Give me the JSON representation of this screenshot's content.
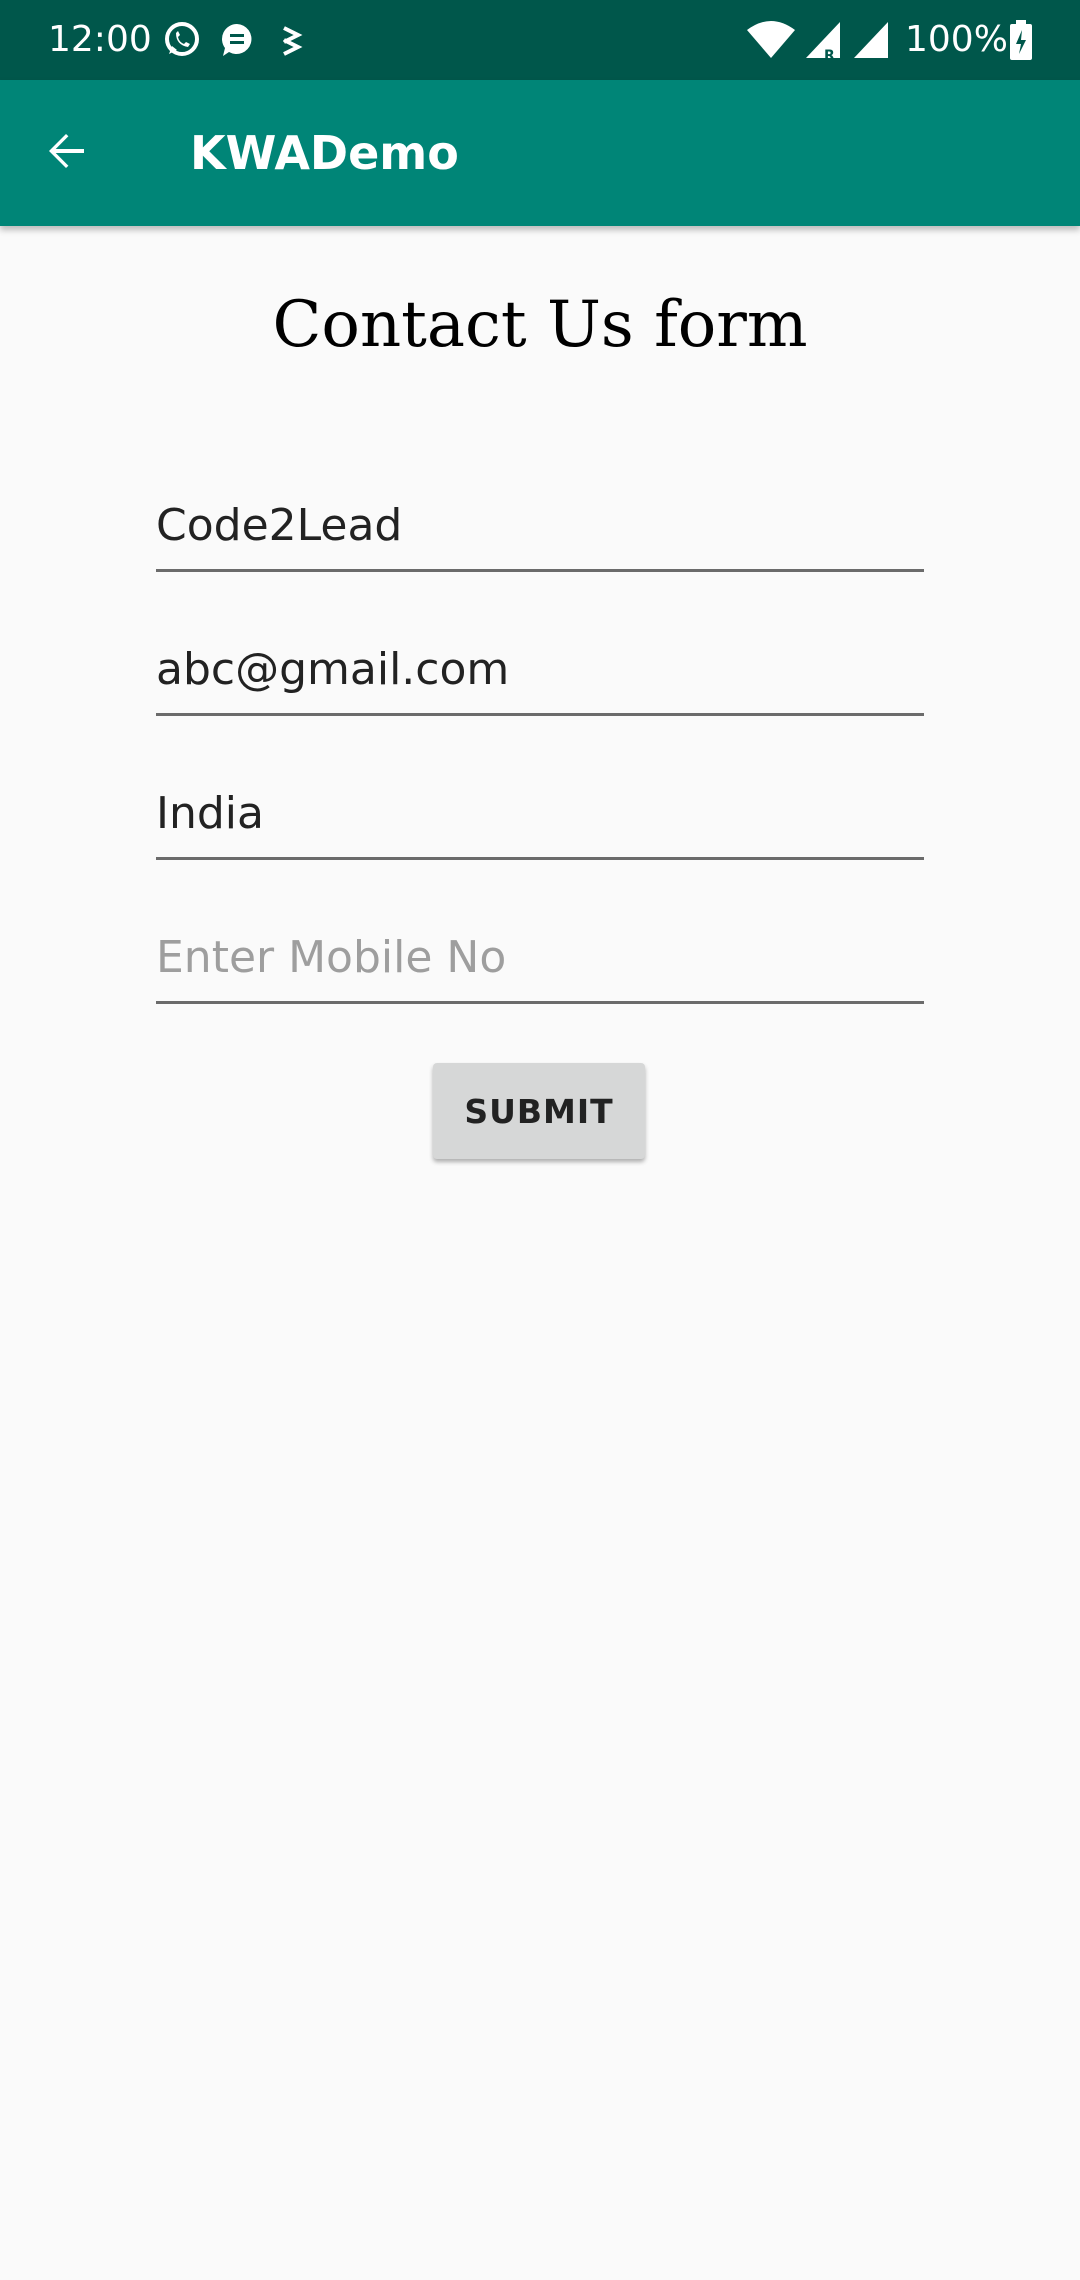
{
  "status_bar": {
    "time": "12:00",
    "battery": "100%",
    "icons": [
      "whatsapp-icon",
      "chat-icon",
      "notification-icon",
      "wifi-icon",
      "signal-roaming-icon",
      "signal-icon",
      "battery-charging-icon"
    ]
  },
  "app_bar": {
    "title": "KWADemo",
    "back_icon": "arrow-back-icon",
    "color": "#008577"
  },
  "form": {
    "title": "Contact Us form",
    "fields": [
      {
        "value": "Code2Lead",
        "placeholder": ""
      },
      {
        "value": "abc@gmail.com",
        "placeholder": ""
      },
      {
        "value": "India",
        "placeholder": ""
      },
      {
        "value": "",
        "placeholder": "Enter Mobile No"
      }
    ],
    "submit_label": "SUBMIT"
  },
  "colors": {
    "status_bar": "#00574b",
    "app_bar": "#008577",
    "background": "#fafafa"
  }
}
